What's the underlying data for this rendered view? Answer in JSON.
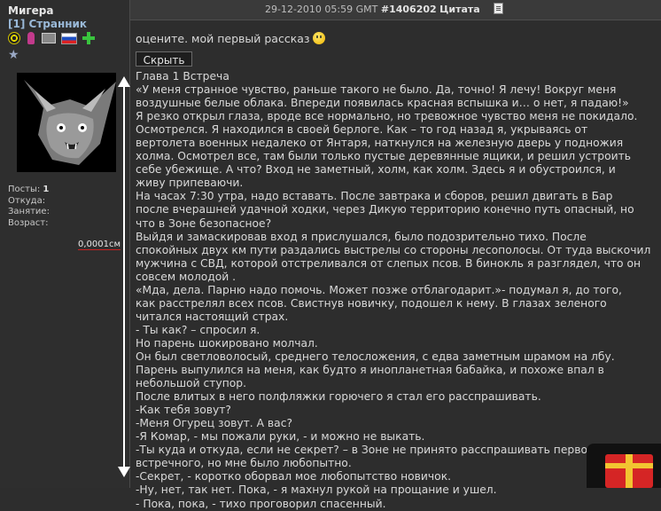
{
  "user": {
    "name": "Мигера",
    "rank": "[1] Странник",
    "stats": [
      {
        "label": "Посты:",
        "value": "1"
      },
      {
        "label": "Откуда:",
        "value": ""
      },
      {
        "label": "Занятие:",
        "value": ""
      },
      {
        "label": "Возраст:",
        "value": ""
      }
    ],
    "reputation": "0,0001см"
  },
  "post": {
    "date": "29-12-2010 05:59 GMT",
    "number": "#1406202",
    "quote_label": "Цитата",
    "lead": "оцените. мой первый рассказ",
    "hide_button": "Скрыть",
    "lines": [
      "Глава 1 Встреча",
      "«У меня странное чувство, раньше такого не было. Да, точно! Я лечу! Вокруг меня",
      "воздушные белые облака. Впереди появилась красная вспышка и… о нет, я падаю!»",
      "Я резко открыл глаза, вроде все нормально, но тревожное чувство меня не покидало.",
      "Осмотрелся. Я находился в своей берлоге. Как – то год назад я, укрываясь от",
      "вертолета военных недалеко от Янтаря, наткнулся на железную дверь у подножия",
      "холма. Осмотрел все, там были только пустые деревянные ящики, и решил устроить",
      "себе убежище. А что? Вход не заметный, холм, как холм. Здесь я и обустроился, и",
      "живу припеваючи.",
      "На часах 7:30 утра, надо вставать. После завтрака и сборов, решил двигать в Бар",
      "после вчерашней удачной ходки, через Дикую территорию конечно путь опасный, но",
      "что в Зоне безопасное?",
      "Выйдя и замаскировав вход я прислушался, было подозрительно тихо. После",
      "спокойных двух км пути раздались выстрелы со стороны лесополосы. От туда выскочил",
      "мужчина с СВД, которой отстреливался от слепых псов. В бинокль я разглядел, что он",
      "совсем молодой .",
      "«Мда, дела. Парню надо помочь. Может позже отблагодарит.»- подумал я, до того,",
      "как расстрелял всех псов. Свистнув новичку, подошел к нему. В глазах зеленого",
      "читался настоящий страх.",
      "- Ты как? – спросил я.",
      "Но парень шокировано молчал.",
      "Он был светловолосый, среднего телосложения, с едва заметным шрамом на лбу.",
      "Парень выпулился на меня, как будто я инопланетная бабайка, и похоже впал в",
      "небольшой ступор.",
      "После влитых в него полфляжки горючего я стал его расспрашивать.",
      "-Как тебя зовут?",
      "-Меня Огурец зовут. А вас?",
      "-Я Комар, - мы пожали руки, - и можно не выкать.",
      "-Ты куда и откуда, если не секрет? – в Зоне не принято расспрашивать первого",
      "встречного, но мне было любопытно.",
      "-Секрет, - коротко оборвал мое любопытство новичок.",
      "-Ну, нет, так нет. Пока, - я махнул рукой на прощание и ушел.",
      "- Пока, пока, - тихо проговорил спасенный."
    ]
  },
  "icons": [
    "radiation-icon",
    "user-icon",
    "message-icon",
    "flag-ru-icon",
    "add-friend-icon",
    "star-icon",
    "document-icon",
    "smile-icon",
    "gift-icon"
  ]
}
